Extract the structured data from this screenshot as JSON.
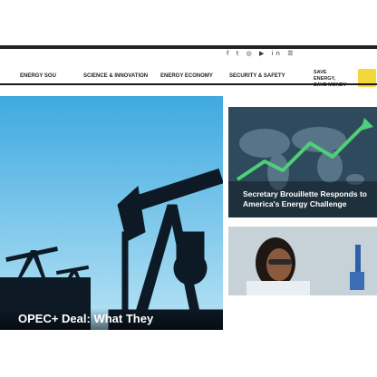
{
  "header": {
    "social_icons": [
      "facebook-icon",
      "twitter-icon",
      "instagram-icon",
      "youtube-icon",
      "linkedin-icon",
      "rss-icon"
    ],
    "social_glyphs": "f  t  ◎  ▶  in  ☰"
  },
  "nav": {
    "items": [
      {
        "label": "Energy Sou"
      },
      {
        "label": "Science & Innovation"
      },
      {
        "label": "Energy Economy"
      },
      {
        "label": "Security & Safety"
      }
    ],
    "save_label": "Save Energy, Save Money"
  },
  "hero": {
    "title": "OPEC+ Deal: What They"
  },
  "cards": [
    {
      "title": "Secretary Brouillette Responds to America's Energy Challenge"
    },
    {
      "title": ""
    }
  ],
  "colors": {
    "hero_sky_top": "#3fa9e0",
    "hero_sky_bottom": "#b7e3f5",
    "silhouette": "#0d1a26",
    "card1_bg": "#2e4a5c",
    "accent_yellow": "#f4d73b"
  }
}
